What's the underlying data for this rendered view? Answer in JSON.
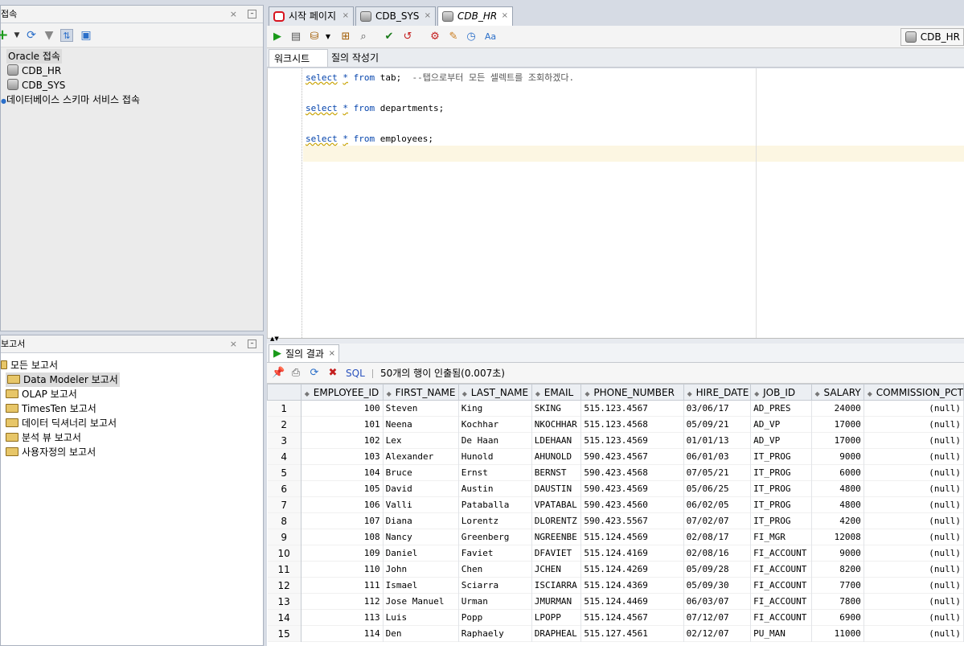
{
  "connections_panel": {
    "title": "접속",
    "close": "×",
    "tree": {
      "root": "Oracle 접속",
      "items": [
        "CDB_HR",
        "CDB_SYS"
      ],
      "schema_service": "데이터베이스 스키마 서비스 접속"
    }
  },
  "reports_panel": {
    "title": "보고서",
    "close": "×",
    "root": "모든 보고서",
    "items": [
      "Data Modeler 보고서",
      "OLAP 보고서",
      "TimesTen 보고서",
      "데이터 딕셔너리 보고서",
      "분석 뷰 보고서",
      "사용자정의 보고서"
    ]
  },
  "editor_tabs": [
    {
      "label": "시작 페이지",
      "close": "×"
    },
    {
      "label": "CDB_SYS",
      "close": "×"
    },
    {
      "label": "CDB_HR",
      "close": "×"
    }
  ],
  "connection_selector": "CDB_HR",
  "sub_tabs": [
    "워크시트",
    "질의 작성기"
  ],
  "code": {
    "line1": {
      "kw1": "select",
      "star": "*",
      "kw2": "from",
      "rest": " tab;  ",
      "comment": "--탭으로부터 모든 셀렉트를 조회하겠다."
    },
    "line2": {
      "kw1": "select",
      "star": "*",
      "kw2": "from",
      "rest": " departments;"
    },
    "line3": {
      "kw1": "select",
      "star": "*",
      "kw2": "from",
      "rest": " employees;"
    }
  },
  "results": {
    "tab_label": "질의 결과",
    "tab_close": "×",
    "sql_link": "SQL",
    "status": "50개의 행이 인출됨(0.007초)",
    "columns": [
      "EMPLOYEE_ID",
      "FIRST_NAME",
      "LAST_NAME",
      "EMAIL",
      "PHONE_NUMBER",
      "HIRE_DATE",
      "JOB_ID",
      "SALARY",
      "COMMISSION_PCT"
    ],
    "rows": [
      [
        "1",
        "100",
        "Steven",
        "King",
        "SKING",
        "515.123.4567",
        "03/06/17",
        "AD_PRES",
        "24000",
        "(null)"
      ],
      [
        "2",
        "101",
        "Neena",
        "Kochhar",
        "NKOCHHAR",
        "515.123.4568",
        "05/09/21",
        "AD_VP",
        "17000",
        "(null)"
      ],
      [
        "3",
        "102",
        "Lex",
        "De Haan",
        "LDEHAAN",
        "515.123.4569",
        "01/01/13",
        "AD_VP",
        "17000",
        "(null)"
      ],
      [
        "4",
        "103",
        "Alexander",
        "Hunold",
        "AHUNOLD",
        "590.423.4567",
        "06/01/03",
        "IT_PROG",
        "9000",
        "(null)"
      ],
      [
        "5",
        "104",
        "Bruce",
        "Ernst",
        "BERNST",
        "590.423.4568",
        "07/05/21",
        "IT_PROG",
        "6000",
        "(null)"
      ],
      [
        "6",
        "105",
        "David",
        "Austin",
        "DAUSTIN",
        "590.423.4569",
        "05/06/25",
        "IT_PROG",
        "4800",
        "(null)"
      ],
      [
        "7",
        "106",
        "Valli",
        "Pataballa",
        "VPATABAL",
        "590.423.4560",
        "06/02/05",
        "IT_PROG",
        "4800",
        "(null)"
      ],
      [
        "8",
        "107",
        "Diana",
        "Lorentz",
        "DLORENTZ",
        "590.423.5567",
        "07/02/07",
        "IT_PROG",
        "4200",
        "(null)"
      ],
      [
        "9",
        "108",
        "Nancy",
        "Greenberg",
        "NGREENBE",
        "515.124.4569",
        "02/08/17",
        "FI_MGR",
        "12008",
        "(null)"
      ],
      [
        "10",
        "109",
        "Daniel",
        "Faviet",
        "DFAVIET",
        "515.124.4169",
        "02/08/16",
        "FI_ACCOUNT",
        "9000",
        "(null)"
      ],
      [
        "11",
        "110",
        "John",
        "Chen",
        "JCHEN",
        "515.124.4269",
        "05/09/28",
        "FI_ACCOUNT",
        "8200",
        "(null)"
      ],
      [
        "12",
        "111",
        "Ismael",
        "Sciarra",
        "ISCIARRA",
        "515.124.4369",
        "05/09/30",
        "FI_ACCOUNT",
        "7700",
        "(null)"
      ],
      [
        "13",
        "112",
        "Jose Manuel",
        "Urman",
        "JMURMAN",
        "515.124.4469",
        "06/03/07",
        "FI_ACCOUNT",
        "7800",
        "(null)"
      ],
      [
        "14",
        "113",
        "Luis",
        "Popp",
        "LPOPP",
        "515.124.4567",
        "07/12/07",
        "FI_ACCOUNT",
        "6900",
        "(null)"
      ],
      [
        "15",
        "114",
        "Den",
        "Raphaely",
        "DRAPHEAL",
        "515.127.4561",
        "02/12/07",
        "PU_MAN",
        "11000",
        "(null)"
      ]
    ]
  }
}
